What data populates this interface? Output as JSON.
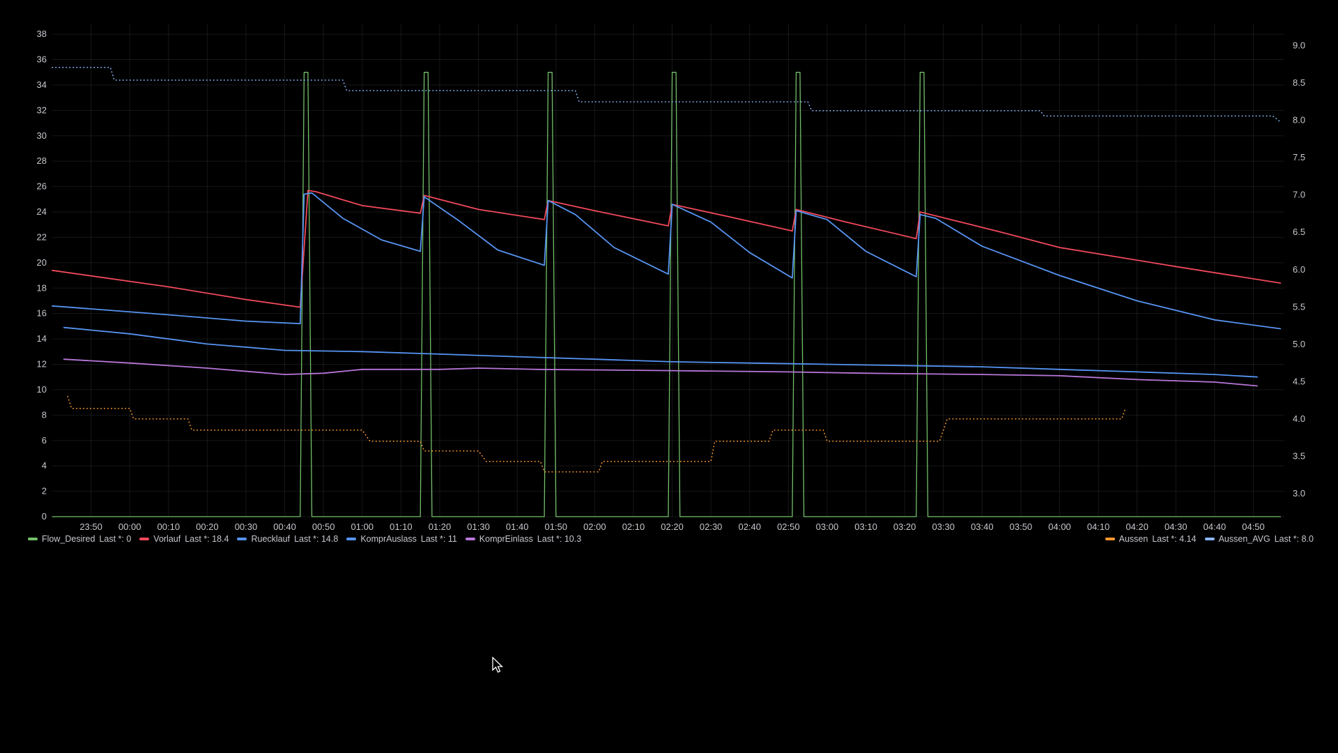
{
  "chart_data": {
    "type": "line",
    "y_left": {
      "ticks": [
        0,
        2,
        4,
        6,
        8,
        10,
        12,
        14,
        16,
        18,
        20,
        22,
        24,
        26,
        28,
        30,
        32,
        34,
        36,
        38
      ],
      "range": [
        0,
        38.5
      ]
    },
    "y_right": {
      "ticks": [
        "3.0",
        "3.5",
        "4.0",
        "4.5",
        "5.0",
        "5.5",
        "6.0",
        "6.5",
        "7.0",
        "7.5",
        "8.0",
        "8.5",
        "9.0"
      ],
      "range": [
        2.69,
        9.24
      ]
    },
    "x_range": [
      "23:40",
      "04:58"
    ],
    "x_ticks": [
      "23:50",
      "00:00",
      "00:10",
      "00:20",
      "00:30",
      "00:40",
      "00:50",
      "01:00",
      "01:10",
      "01:20",
      "01:30",
      "01:40",
      "01:50",
      "02:00",
      "02:10",
      "02:20",
      "02:30",
      "02:40",
      "02:50",
      "03:00",
      "03:10",
      "03:20",
      "03:30",
      "03:40",
      "03:50",
      "04:00",
      "04:10",
      "04:20",
      "04:30",
      "04:40",
      "04:50"
    ],
    "grid": true,
    "legend_placement": "bottom",
    "series": [
      {
        "name": "Flow_Desired",
        "color": "#73bf69",
        "axis": "left",
        "style": "solid",
        "points": [
          [
            "23:40",
            0
          ],
          [
            "00:44",
            0
          ],
          [
            "00:45",
            35
          ],
          [
            "00:46",
            35
          ],
          [
            "00:47",
            0
          ],
          [
            "01:15",
            0
          ],
          [
            "01:16",
            35
          ],
          [
            "01:17",
            35
          ],
          [
            "01:18",
            0
          ],
          [
            "01:47",
            0
          ],
          [
            "01:48",
            35
          ],
          [
            "01:49",
            35
          ],
          [
            "01:50",
            0
          ],
          [
            "02:19",
            0
          ],
          [
            "02:20",
            35
          ],
          [
            "02:21",
            35
          ],
          [
            "02:22",
            0
          ],
          [
            "02:51",
            0
          ],
          [
            "02:52",
            35
          ],
          [
            "02:53",
            35
          ],
          [
            "02:54",
            0
          ],
          [
            "03:23",
            0
          ],
          [
            "03:24",
            35
          ],
          [
            "03:25",
            35
          ],
          [
            "03:26",
            0
          ],
          [
            "04:57",
            0
          ]
        ]
      },
      {
        "name": "Vorlauf",
        "color": "#f2495c",
        "axis": "left",
        "style": "solid",
        "points": [
          [
            "23:40",
            19.4
          ],
          [
            "00:10",
            18.1
          ],
          [
            "00:30",
            17.1
          ],
          [
            "00:44",
            16.5
          ],
          [
            "00:46",
            25.7
          ],
          [
            "00:48",
            25.6
          ],
          [
            "01:00",
            24.5
          ],
          [
            "01:15",
            23.9
          ],
          [
            "01:16",
            25.3
          ],
          [
            "01:30",
            24.2
          ],
          [
            "01:47",
            23.4
          ],
          [
            "01:48",
            24.9
          ],
          [
            "02:00",
            24.1
          ],
          [
            "02:19",
            22.9
          ],
          [
            "02:20",
            24.6
          ],
          [
            "02:35",
            23.6
          ],
          [
            "02:51",
            22.5
          ],
          [
            "02:52",
            24.2
          ],
          [
            "03:05",
            23.2
          ],
          [
            "03:23",
            21.9
          ],
          [
            "03:24",
            24.0
          ],
          [
            "03:45",
            22.4
          ],
          [
            "04:00",
            21.2
          ],
          [
            "04:30",
            19.7
          ],
          [
            "04:57",
            18.4
          ]
        ]
      },
      {
        "name": "Ruecklauf",
        "color": "#5794f2",
        "axis": "left",
        "style": "solid",
        "points": [
          [
            "23:40",
            16.6
          ],
          [
            "00:10",
            15.9
          ],
          [
            "00:30",
            15.4
          ],
          [
            "00:44",
            15.2
          ],
          [
            "00:45",
            25.4
          ],
          [
            "00:47",
            25.5
          ],
          [
            "00:55",
            23.5
          ],
          [
            "01:05",
            21.8
          ],
          [
            "01:15",
            20.9
          ],
          [
            "01:16",
            25.2
          ],
          [
            "01:25",
            23.3
          ],
          [
            "01:35",
            21.0
          ],
          [
            "01:47",
            19.8
          ],
          [
            "01:48",
            24.9
          ],
          [
            "01:55",
            23.8
          ],
          [
            "02:05",
            21.2
          ],
          [
            "02:19",
            19.1
          ],
          [
            "02:20",
            24.6
          ],
          [
            "02:30",
            23.2
          ],
          [
            "02:40",
            20.8
          ],
          [
            "02:51",
            18.8
          ],
          [
            "02:52",
            24.1
          ],
          [
            "03:00",
            23.4
          ],
          [
            "03:10",
            20.9
          ],
          [
            "03:23",
            18.9
          ],
          [
            "03:24",
            23.8
          ],
          [
            "03:28",
            23.5
          ],
          [
            "03:40",
            21.3
          ],
          [
            "04:00",
            19.0
          ],
          [
            "04:20",
            17.0
          ],
          [
            "04:40",
            15.5
          ],
          [
            "04:57",
            14.8
          ]
        ]
      },
      {
        "name": "KomprAuslass",
        "color": "#5794f2",
        "axis": "left",
        "style": "solid",
        "points": [
          [
            "23:43",
            14.9
          ],
          [
            "00:00",
            14.4
          ],
          [
            "00:20",
            13.6
          ],
          [
            "00:40",
            13.1
          ],
          [
            "01:00",
            13.0
          ],
          [
            "01:20",
            12.8
          ],
          [
            "01:40",
            12.6
          ],
          [
            "02:00",
            12.4
          ],
          [
            "02:20",
            12.2
          ],
          [
            "02:40",
            12.1
          ],
          [
            "03:00",
            12.0
          ],
          [
            "03:20",
            11.9
          ],
          [
            "03:40",
            11.8
          ],
          [
            "04:00",
            11.6
          ],
          [
            "04:20",
            11.4
          ],
          [
            "04:40",
            11.2
          ],
          [
            "04:51",
            11.0
          ]
        ]
      },
      {
        "name": "KomprEinlass",
        "color": "#b877d9",
        "axis": "left",
        "style": "solid",
        "points": [
          [
            "23:43",
            12.4
          ],
          [
            "00:00",
            12.1
          ],
          [
            "00:20",
            11.7
          ],
          [
            "00:40",
            11.2
          ],
          [
            "00:50",
            11.3
          ],
          [
            "01:00",
            11.6
          ],
          [
            "01:20",
            11.6
          ],
          [
            "01:30",
            11.7
          ],
          [
            "01:45",
            11.6
          ],
          [
            "02:20",
            11.5
          ],
          [
            "02:50",
            11.4
          ],
          [
            "03:10",
            11.3
          ],
          [
            "03:40",
            11.2
          ],
          [
            "04:00",
            11.1
          ],
          [
            "04:20",
            10.8
          ],
          [
            "04:40",
            10.6
          ],
          [
            "04:51",
            10.3
          ]
        ]
      },
      {
        "name": "Aussen",
        "color": "#ff9830",
        "axis": "right",
        "style": "dotted",
        "points": [
          [
            "23:44",
            4.3
          ],
          [
            "23:45",
            4.14
          ],
          [
            "00:00",
            4.14
          ],
          [
            "00:01",
            4.0
          ],
          [
            "00:15",
            4.0
          ],
          [
            "00:16",
            3.85
          ],
          [
            "01:00",
            3.85
          ],
          [
            "01:02",
            3.7
          ],
          [
            "01:15",
            3.7
          ],
          [
            "01:16",
            3.57
          ],
          [
            "01:30",
            3.57
          ],
          [
            "01:32",
            3.43
          ],
          [
            "01:46",
            3.43
          ],
          [
            "01:47",
            3.29
          ],
          [
            "02:01",
            3.29
          ],
          [
            "02:02",
            3.43
          ],
          [
            "02:30",
            3.43
          ],
          [
            "02:31",
            3.7
          ],
          [
            "02:45",
            3.7
          ],
          [
            "02:46",
            3.85
          ],
          [
            "02:59",
            3.85
          ],
          [
            "03:00",
            3.7
          ],
          [
            "03:29",
            3.7
          ],
          [
            "03:31",
            4.0
          ],
          [
            "04:16",
            4.0
          ],
          [
            "04:17",
            4.14
          ]
        ]
      },
      {
        "name": "Aussen_AVG",
        "color": "#8ab8ff",
        "axis": "right",
        "style": "dotted",
        "points": [
          [
            "23:40",
            8.71
          ],
          [
            "23:55",
            8.71
          ],
          [
            "23:56",
            8.54
          ],
          [
            "00:55",
            8.54
          ],
          [
            "00:56",
            8.4
          ],
          [
            "01:55",
            8.4
          ],
          [
            "01:56",
            8.25
          ],
          [
            "02:55",
            8.25
          ],
          [
            "02:56",
            8.13
          ],
          [
            "03:55",
            8.13
          ],
          [
            "03:56",
            8.06
          ],
          [
            "04:55",
            8.06
          ],
          [
            "04:57",
            7.98
          ]
        ]
      }
    ]
  },
  "legend_left": [
    {
      "name": "Flow_Desired",
      "last": "Last *: 0",
      "color": "#73bf69"
    },
    {
      "name": "Vorlauf",
      "last": "Last *: 18.4",
      "color": "#f2495c"
    },
    {
      "name": "Ruecklauf",
      "last": "Last *: 14.8",
      "color": "#5794f2"
    },
    {
      "name": "KomprAuslass",
      "last": "Last *: 11",
      "color": "#5794f2"
    },
    {
      "name": "KomprEinlass",
      "last": "Last *: 10.3",
      "color": "#b877d9"
    }
  ],
  "legend_right": [
    {
      "name": "Aussen",
      "last": "Last *: 4.14",
      "color": "#ff9830"
    },
    {
      "name": "Aussen_AVG",
      "last": "Last *: 8.0",
      "color": "#8ab8ff"
    }
  ]
}
